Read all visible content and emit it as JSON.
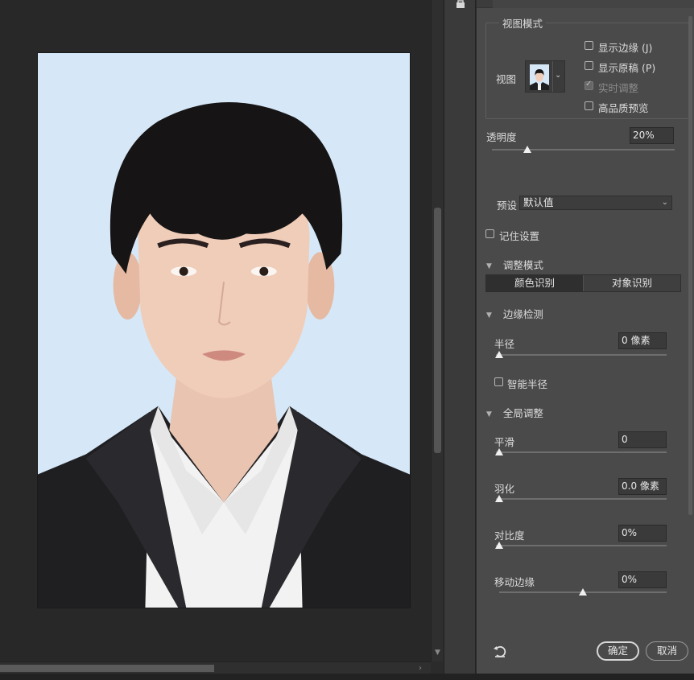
{
  "view_mode": {
    "group_title": "视图模式",
    "view_label": "视图",
    "options": [
      {
        "label": "显示边缘 (J)",
        "checked": false,
        "disabled": false
      },
      {
        "label": "显示原稿 (P)",
        "checked": false,
        "disabled": false
      },
      {
        "label": "实时调整",
        "checked": true,
        "disabled": true
      },
      {
        "label": "高品质预览",
        "checked": false,
        "disabled": false
      }
    ]
  },
  "opacity": {
    "label": "透明度",
    "value": "20%",
    "level": 0.2
  },
  "preset": {
    "label": "预设",
    "value": "默认值"
  },
  "remember": {
    "label": "记住设置",
    "checked": false
  },
  "adjust_mode": {
    "title": "调整模式",
    "tabs": [
      {
        "label": "颜色识别",
        "active": true
      },
      {
        "label": "对象识别",
        "active": false
      }
    ]
  },
  "edge_detection": {
    "title": "边缘检测",
    "radius": {
      "label": "半径",
      "value": "0 像素",
      "level": 0
    },
    "smart_radius": {
      "label": "智能半径",
      "checked": false
    }
  },
  "global_adjust": {
    "title": "全局调整",
    "smooth": {
      "label": "平滑",
      "value": "0",
      "level": 0
    },
    "feather": {
      "label": "羽化",
      "value": "0.0 像素",
      "level": 0
    },
    "contrast": {
      "label": "对比度",
      "value": "0%",
      "level": 0
    },
    "shift_edge": {
      "label": "移动边缘",
      "value": "0%",
      "level": 0.5
    }
  },
  "buttons": {
    "ok": "确定",
    "cancel": "取消"
  },
  "icons": {
    "reset": "reset-icon",
    "lock": "lock-icon",
    "chevron": "chevron-down-icon",
    "collapse": "triangle-down-icon"
  },
  "colors": {
    "panel_bg": "#4a4a4a",
    "canvas_bg": "#282828",
    "photo_bg": "#d6e8f8"
  }
}
